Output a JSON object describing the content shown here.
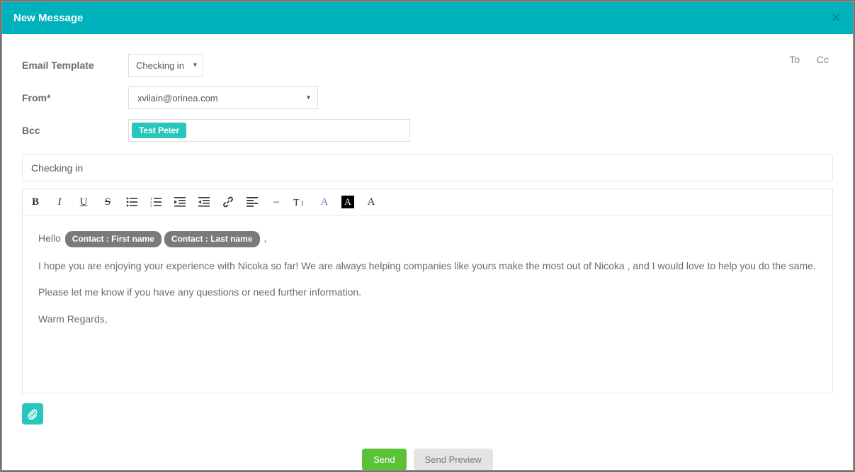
{
  "dialog": {
    "title": "New Message"
  },
  "labels": {
    "email_template": "Email Template",
    "from": "From*",
    "bcc": "Bcc"
  },
  "links": {
    "to": "To",
    "cc": "Cc"
  },
  "fields": {
    "template_selected": "Checking in",
    "from_selected": "xvilain@orinea.com",
    "bcc_tag": "Test Peter",
    "subject": "Checking in"
  },
  "body": {
    "greeting_prefix": "Hello ",
    "pill_first": "Contact : First name",
    "pill_last": "Contact : Last name",
    "greeting_suffix": " ,",
    "p1": "I hope you are enjoying your experience with Nicoka so far! We are always helping companies like yours make the most out of Nicoka , and I would love to help you do the same.",
    "p2": "Please let me know if you have any questions or need further information.",
    "p3": "Warm Regards,"
  },
  "toolbar": {
    "bold": "B",
    "italic": "I",
    "underline": "U",
    "strike": "S",
    "hr": "–",
    "textsize": "T",
    "fontcolor": "A",
    "bgcolor": "A",
    "clear": "A"
  },
  "buttons": {
    "send": "Send",
    "preview": "Send Preview"
  }
}
